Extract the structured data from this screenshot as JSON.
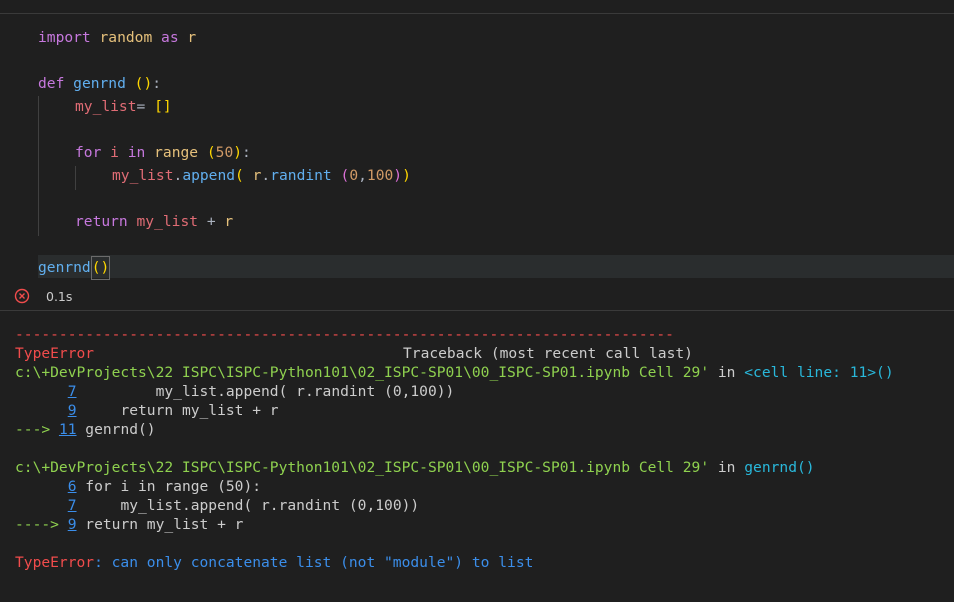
{
  "code": {
    "l1": {
      "import": "import",
      "module": "random",
      "as": "as",
      "alias": "r"
    },
    "l2": {
      "def": "def",
      "name": "genrnd",
      "sp": " ",
      "open": "(",
      "close": ")",
      "colon": ":"
    },
    "l3": {
      "var": "my_list",
      "eq": "= ",
      "list": "[]"
    },
    "l4": {
      "for": "for",
      "i": "i",
      "in": "in",
      "range": "range",
      "open": "(",
      "num": "50",
      "close": ")",
      "colon": ":"
    },
    "l5": {
      "var": "my_list",
      "dot": ".",
      "method": "append",
      "open": "(",
      "sp": " ",
      "r": "r",
      "dot2": ".",
      "randint": "randint",
      "sp2": " ",
      "open2": "(",
      "n1": "0",
      "comma": ",",
      "n2": "100",
      "close2": ")",
      "close": ")"
    },
    "l6": {
      "return": "return",
      "var": "my_list",
      "plus": "+",
      "r": "r"
    },
    "l7": {
      "name": "genrnd",
      "parens": "()"
    }
  },
  "status": {
    "time": "0.1s"
  },
  "output": {
    "dashes": "---------------------------------------------------------------------------",
    "error_type": "TypeError",
    "traceback_label": "Traceback (most recent call last)",
    "frame1": {
      "path": "c:\\+DevProjects\\22 ISPC\\ISPC-Python101\\02_ISPC-SP01\\00_ISPC-SP01.ipynb Cell 29'",
      "in": " in ",
      "loc": "<cell line: 11>()",
      "lines": [
        {
          "arrow": "      ",
          "num": "7",
          "code": "         my_list.append( r.randint (0,100))"
        },
        {
          "arrow": "      ",
          "num": "9",
          "code": "     return my_list + r"
        },
        {
          "arrow": "---> ",
          "num": "11",
          "code": " genrnd()"
        }
      ]
    },
    "frame2": {
      "path": "c:\\+DevProjects\\22 ISPC\\ISPC-Python101\\02_ISPC-SP01\\00_ISPC-SP01.ipynb Cell 29'",
      "in": " in ",
      "loc": "genrnd()",
      "lines": [
        {
          "arrow": "      ",
          "num": "6",
          "code": " for i in range (50):"
        },
        {
          "arrow": "      ",
          "num": "7",
          "code": "     my_list.append( r.randint (0,100))"
        },
        {
          "arrow": "----> ",
          "num": "9",
          "code": " return my_list + r"
        }
      ]
    },
    "final_error_type": "TypeError",
    "final_message": ": can only concatenate list (not \"module\") to list"
  }
}
